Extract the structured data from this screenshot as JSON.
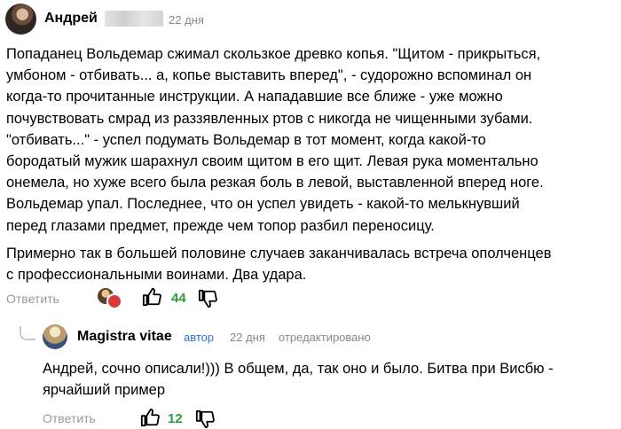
{
  "comment": {
    "author": "Андрей",
    "time": "22 дня",
    "paragraphs": [
      "Попаданец Вольдемар сжимал скользкое древко копья. \"Щитом - прикрыться,",
      "умбоном - отбивать... а, копье выставить вперед\", - судорожно вспоминал он",
      "когда-то прочитанные инструкции. А нападавшие все ближе - уже можно",
      "почувствовать смрад из раззявленных ртов с никогда не чищенными зубами.",
      "\"отбивать...\" - успел подумать Вольдемар в тот момент, когда какой-то",
      "бородатый мужик шарахнул своим щитом в его щит. Левая рука моментально",
      "онемела, но хуже всего была резкая боль в левой, выставленной вперед ноге.",
      "Вольдемар упал. Последнее, что он успел увидеть - какой-то мелькнувший",
      "перед глазами предмет, прежде чем топор разбил переносицу.",
      "Примерно так в большей половине случаев заканчивалась встреча ополченцев",
      "с профессиональными воинами. Два удара."
    ],
    "reply_label": "Ответить",
    "likes": "44"
  },
  "reply": {
    "author": "Magistra vitae",
    "author_tag": "автор",
    "time": "22 дня",
    "edited": "отредактировано",
    "lines": [
      "Андрей, сочно описали!))) В общем, да, так оно и было. Битва при Висбю -",
      "ярчайший пример"
    ],
    "reply_label": "Ответить",
    "likes": "12"
  },
  "colors": {
    "like_count": "#2e9a3c",
    "author_tag": "#2b74d4",
    "muted": "#888888"
  }
}
